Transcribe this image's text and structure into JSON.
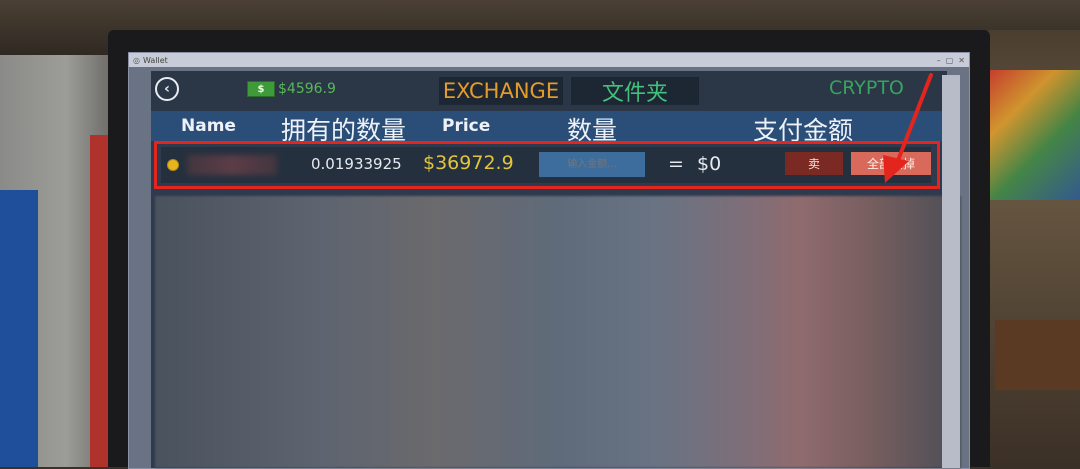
{
  "window": {
    "title": "Wallet",
    "controls": [
      "–",
      "▢",
      "✕"
    ]
  },
  "topbar": {
    "back_icon": "back-arrow-icon",
    "cash_icon_glyph": "$",
    "balance": "$4596.9",
    "tabs": {
      "exchange": "EXCHANGE",
      "folder": "文件夹",
      "crypto": "CRYPTO"
    }
  },
  "table": {
    "headers": {
      "name": "Name",
      "owned": "拥有的数量",
      "price": "Price",
      "quantity": "数量",
      "payment": "支付金额"
    },
    "rows": [
      {
        "owned": "0.01933925",
        "price": "$36972.9",
        "amount_placeholder": "输入金额...",
        "equals": "=",
        "pay": "$0",
        "sell_label": "卖",
        "sell_all_label": "全部卖掉"
      }
    ]
  },
  "colors": {
    "highlight_outline": "#e3251e",
    "price": "#e3c43a",
    "exchange_tab": "#e39b2b",
    "crypto_tab": "#37a35f",
    "sell_all": "#d9695a"
  }
}
